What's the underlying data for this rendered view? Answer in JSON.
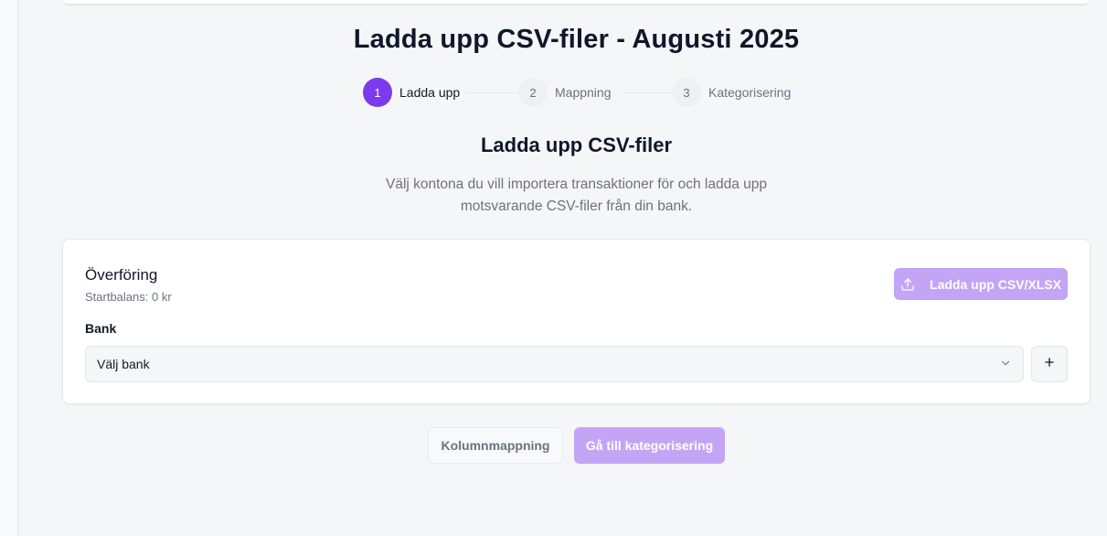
{
  "page": {
    "title": "Ladda upp CSV-filer - Augusti 2025"
  },
  "stepper": {
    "steps": [
      {
        "number": "1",
        "label": "Ladda upp",
        "state": "active"
      },
      {
        "number": "2",
        "label": "Mappning",
        "state": "inactive"
      },
      {
        "number": "3",
        "label": "Kategorisering",
        "state": "inactive"
      }
    ]
  },
  "section": {
    "title": "Ladda upp CSV-filer",
    "description": "Välj kontona du vill importera transaktioner för och ladda upp motsvarande CSV-filer från din bank."
  },
  "account_card": {
    "name": "Överföring",
    "start_balance": "Startbalans: 0 kr",
    "upload_label": "Ladda upp CSV/XLSX",
    "upload_icon": "upload-icon",
    "bank_label": "Bank",
    "bank_select_value": "Välj bank",
    "select_icon": "chevron-down-icon",
    "add_icon": "plus-icon"
  },
  "actions": {
    "column_mapping_label": "Kolumnmappning",
    "go_to_categorization_label": "Gå till kategorisering"
  },
  "colors": {
    "accent": "#7c3aed",
    "accent_disabled": "#c4a5f5",
    "background": "#f5f6f8"
  }
}
